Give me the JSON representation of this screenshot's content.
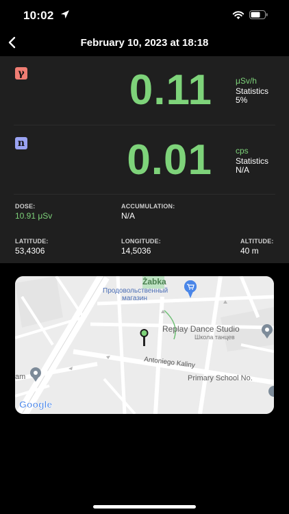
{
  "status_bar": {
    "time": "10:02"
  },
  "nav": {
    "title": "February 10, 2023 at 18:18"
  },
  "gamma": {
    "symbol": "γ",
    "value": "0.11",
    "unit": "μSv/h",
    "stat_label": "Statistics",
    "stat_value": "5%"
  },
  "neutron": {
    "symbol": "n",
    "value": "0.01",
    "unit": "cps",
    "stat_label": "Statistics",
    "stat_value": "N/A"
  },
  "dose": {
    "label": "DOSE:",
    "value": "10.91 μSv"
  },
  "accumulation": {
    "label": "ACCUMULATION:",
    "value": "N/A"
  },
  "latitude": {
    "label": "LATITUDE:",
    "value": "53,4306"
  },
  "longitude": {
    "label": "LONGITUDE:",
    "value": "14,5036"
  },
  "altitude": {
    "label": "ALTITUDE:",
    "value": "40 m"
  },
  "map": {
    "poi_zabka": "Żabka",
    "poi_grocery": "Продовольственный",
    "poi_grocery2": "магазин",
    "poi_dance": "Replay Dance Studio",
    "poi_dance_sub": "Школа танцев",
    "street": "Antoniego Kaliny",
    "poi_school": "Primary School No.",
    "poi_left": "am",
    "logo": "Google"
  },
  "colors": {
    "accent": "#7ed37a",
    "gamma_badge": "#ef7d73",
    "neutron_badge": "#9aa3f2",
    "panel": "#1f1f1f"
  }
}
